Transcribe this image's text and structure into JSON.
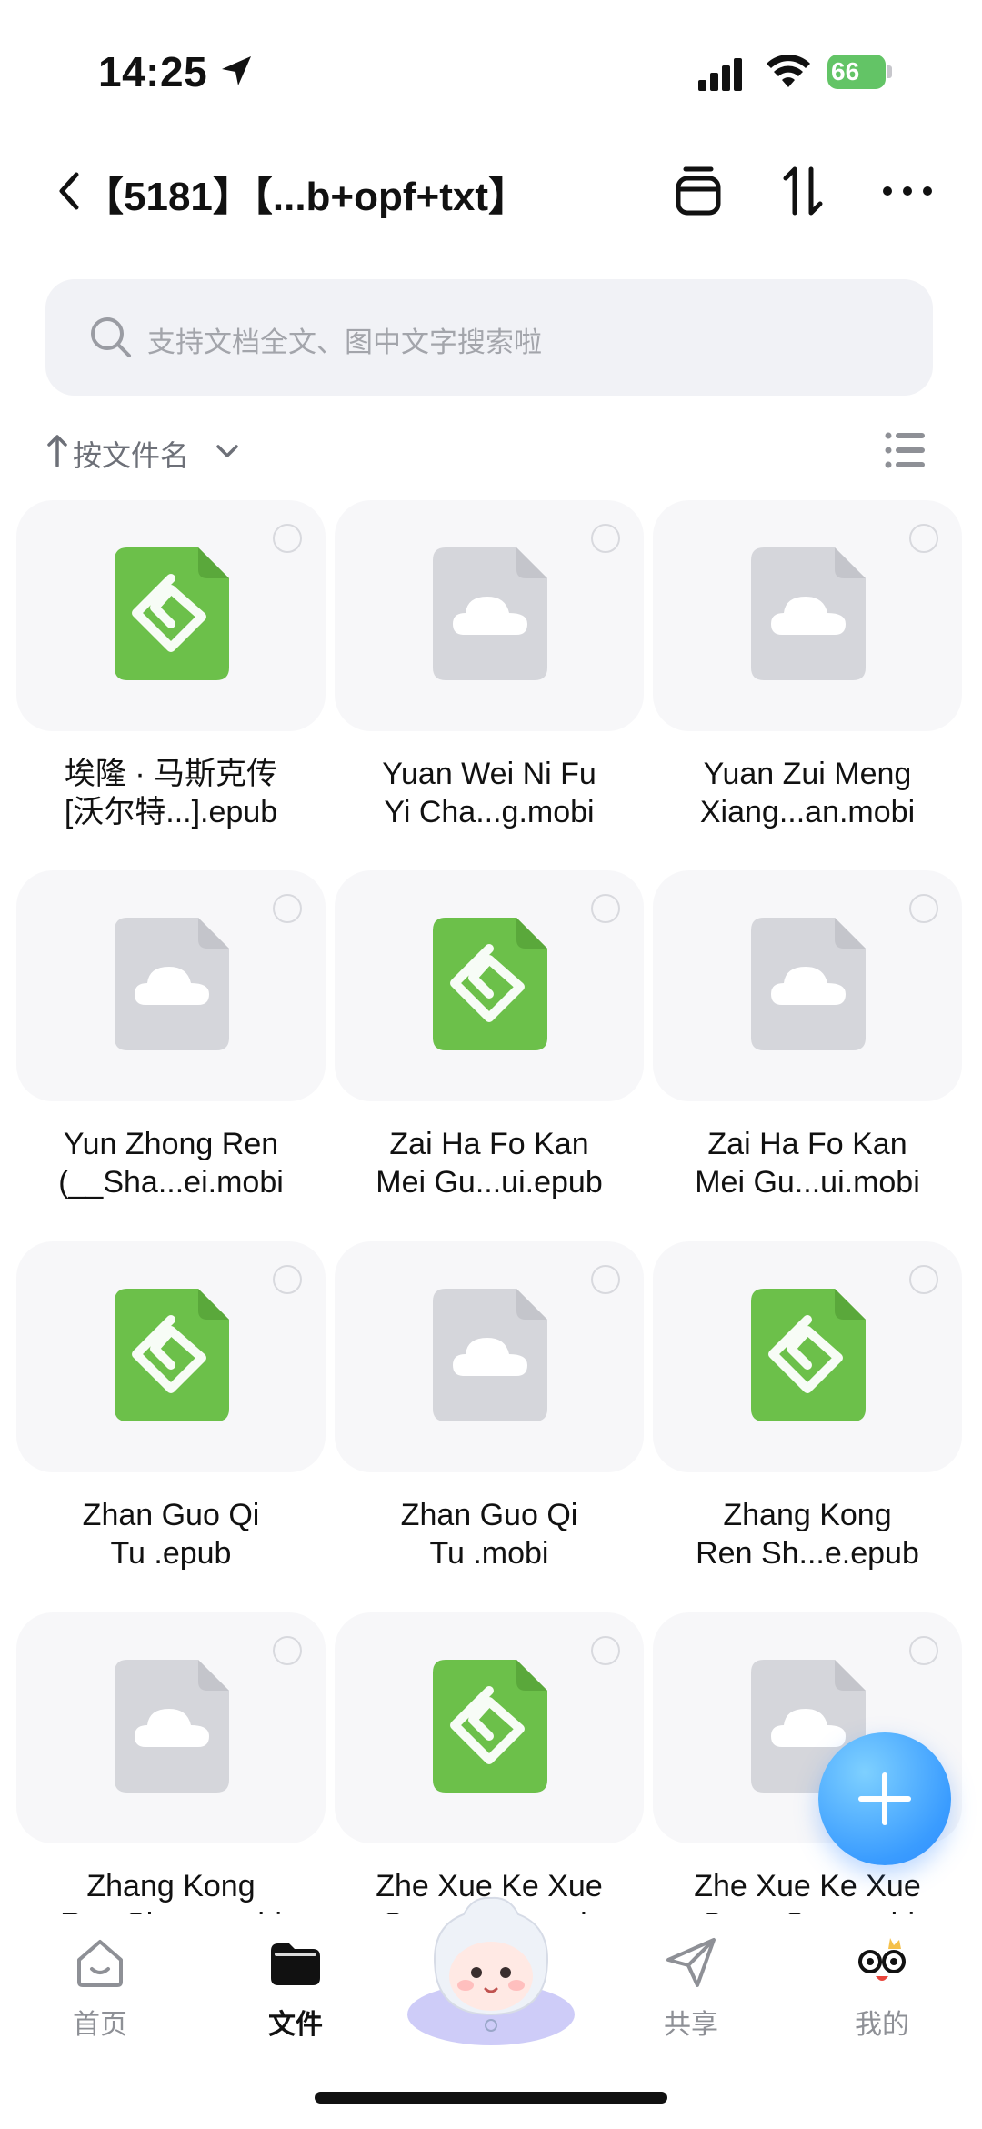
{
  "status_bar": {
    "time": "14:25",
    "battery_percent": "66"
  },
  "header": {
    "title": "【5181】【...b+opf+txt】"
  },
  "search": {
    "placeholder": "支持文档全文、图中文字搜索啦"
  },
  "sort": {
    "label": "按文件名"
  },
  "files": [
    {
      "type": "epub",
      "line1": "埃隆 · 马斯克传",
      "line2": "[沃尔特...].epub"
    },
    {
      "type": "mobi",
      "line1": "Yuan Wei Ni Fu",
      "line2": "Yi Cha...g.mobi"
    },
    {
      "type": "mobi",
      "line1": "Yuan Zui  Meng",
      "line2": "Xiang...an.mobi"
    },
    {
      "type": "mobi",
      "line1": "Yun Zhong Ren",
      "line2": "(__Sha...ei.mobi"
    },
    {
      "type": "epub",
      "line1": "Zai Ha Fo Kan",
      "line2": "Mei Gu...ui.epub"
    },
    {
      "type": "mobi",
      "line1": "Zai Ha Fo Kan",
      "line2": "Mei Gu...ui.mobi"
    },
    {
      "type": "epub",
      "line1": "Zhan Guo Qi",
      "line2": "Tu .epub"
    },
    {
      "type": "mobi",
      "line1": "Zhan Guo Qi",
      "line2": "Tu .mobi"
    },
    {
      "type": "epub",
      "line1": "Zhang Kong",
      "line2": "Ren Sh...e.epub"
    },
    {
      "type": "mobi",
      "line1": "Zhang Kong",
      "line2": "Ren Sh...e.mobi"
    },
    {
      "type": "epub",
      "line1": "Zhe Xue Ke Xue",
      "line2": "Quan S...r.epub"
    },
    {
      "type": "mobi",
      "line1": "Zhe Xue Ke Xue",
      "line2": "Quan S...r.mobi"
    }
  ],
  "bottom_nav": {
    "items": [
      {
        "label": "首页",
        "icon": "home-icon",
        "active": false
      },
      {
        "label": "文件",
        "icon": "folder-icon",
        "active": true
      },
      {
        "label": "",
        "icon": "mascot-icon",
        "active": false
      },
      {
        "label": "共享",
        "icon": "send-icon",
        "active": false
      },
      {
        "label": "我的",
        "icon": "profile-icon",
        "active": false
      }
    ]
  },
  "colors": {
    "epub_green": "#6cc04a",
    "cloud_file_gray": "#d5d6db",
    "fab_blue": "#3a9cff"
  }
}
